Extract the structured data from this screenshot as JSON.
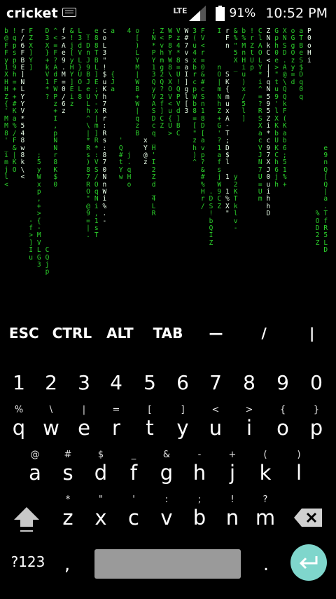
{
  "status_bar": {
    "carrier": "cricket",
    "network": "LTE",
    "battery_percent": "91%",
    "time": "10:52 PM",
    "icons": [
      "keyboard-icon",
      "signal-icon",
      "battery-icon"
    ]
  },
  "matrix": {
    "color": "#2cd22c",
    "columns": [
      "b\n@\nF\nF\ny\n1\nX\nH\nH\nZ\n{\n'\nM\nM\n8\n'\n_\ni\nm\nj\nl\n<",
      "!\nq\np\ns\np\n9\nh\n=\n+\n+\n#\nK\na\n%\n/\nF\n&\n|\nK\nO",
      "r\n/\n6\nF\nB\nE\n]\nN\nL\nY\nY\nV\n*\n5\n4\n8\nw\n8\nk\n\\\n<",
      "F\nZ\nX\n]\nY\n]\n\n\n\n\n\n\n\n\n\n\n\n\n\n\n\n\n\n\n\n\n-\nf\n>\n]\nI\nu",
      "\n\n\n\n\n\n\n\n\n\n\n\n\n\n\n\n\n;\n5\ny\nW\nx\np\n,\n+\n>\n{\n-\nM\nV\nL\nG\n3",
      "D\n3\nX\n}\n+\nk\nV\n1\n*\n?\n\n\n\n\n\n\n\n\n\n\n\n\n\n\n\n\n\n\n\n\nC\nQ\nj\np",
      "^\n<\n=\nF\n?\nA\nd\nF\nW\nP\nz\n+\nI\n,\np\nN\nN\nr\n8\nK\n$\n0",
      "f\n>\nA\ne\n9\n.\nM\n=\n0\n/\n6\nz",
      "&\n!\nj\n[\ny\nH\nY\n]\nE\ni\nz",
      "L\n3\nd\nV\nL\n}\nU\nO\nL\n8",
      "_\n!\nD\nn\nJ\n9\nB\nJ\ne\nU\nL\nh\n^\n\\\n|\n*\nR\ns\n)\n8\n7\nR\nO\n\"\n@\n9\n=\n|\n.",
      "e\n8\n8\nT\nB\nL\n]\nE\n;\nY\n-\nx\n|\nm\n]\nR\n*\n:\nV\nS\n/\nO\nq\nN\ni\n,\n1\ns\nT",
      "c\no\nL\n3\n\"\n!\n$\nu\nK\nh\n7\nR\nr\n:\nR\ns\n:\n8\n7\n0\nN\nn\nW\ni\n%\n.\n-",
      "a\n\n\n\n\n\n{\nJ\na",
      "\n\n\n\n\n\n\n\n\n\n\n\n\n\n\n'\nQ\n#\nt\nY\nw",
      "4\n\n\n\n\n\n\n\n\n\n\n\n\n\n\n\n\nj\n.\nq\nH\no",
      "o\n[\n)\nL\nY\nM\n|\nW\nB\n+\nW\n|\nq\nz\nB",
      "\n\n\n\n\n\n\n\n\n\n\n\n\n\n\nx\nY\n@\nz",
      ";\nN\n*\nP\nY\n1\n3\nQ\ny\nV\nA\nS\nD\nc\nq\n_\nH\n'\nI\n2\nZ\nd\n_\n4\nL\nR",
      "Z\n<\nv\nh\nm\ng\n2\nQ\n?\n2\nf\n]\nC\nZ",
      "W\nP\n8\nY\nW\n8\n\\\nX\nO\nV\n<\nu\n{\nU\n>",
      "V\nz\n4\n*\n8\n=\nU\n!\nQ\nP\nV\nd\n]\nB\nC",
      "W\n#\n7\nv\ns\na\nI\n]\ng\nl\n[\n3",
      "3\n(\nu\n4\nx\nb\nr\nc\np\nW\nb\n8\n=\n[\n\"\nz\nh\n)\n^",
      "F\nV\n<\nr\n=\n0\n&\n#\nc\nS\nn\n1\n8\nD\n[\na\nv\np\n?\n&\n#\n%\nH\nr\n/",
      "\n\n\n\n\n\n\n\n\n\n\n\n\n\n\n\n\n\n\n\n\n\n.\nD\nS\n!\nb\nQ\nI\nZ",
      "I\n\n\n\n\nn\nO\n|\nm\nN\nh\nZ\n+\nG\n'\n?\n1\na\nf\ns\nj\nW\n9\nC\nZ",
      "r\nF\nn\n\n\n\nS\nK\n{\nm\nu\nx\nA\n-\nT\n;\nD\n$\nl\n\n1\n\n1\n%\nX\n\"",
      "&\n%\n\"\n5\nX\n_\n\n\n\n\n\n\n\n\n\n\n\n\n\n\ny\n2\nK\nT\nk\nl\nv\n-",
      "b\n%\nM\nn\nH\ni\nu\n)\nx\n/\n5\nl\n]",
      "!\nr\nZ\nt\nU\np",
      "C\nl\nA\nO\nL\nY\n*\ni\n^\n=\n?\nR\nS\nX\na\nc\nV\nJ\nN\n7\nU\n=\nU\nm",
      "Z\nN\nk\nC\n<\n|\n]\nq\nN\n5\n9\n5\nZ\ni\n*\nc\n9\n7\nX\nJ\n0\nu\ni\nh\nh\nD",
      "G\np\nh\n0\ne\n>\n\"\nt\nu\n9\n'\nl\nX\nK\nb\nU\nK\nC\nh\n6\nj\nh",
      "X\nN\nS\nD\n.\nA\n@\n\\\nQ\nQ\nk\nF\n(\nK\na\nb\n6\n;\n5\n1\n%\n+",
      "o\nG\ng\nO\nz\ny\n=\nd",
      "a\nT\nB\ne\nS\n$\nD\nq\n0\nq",
      "P\n0\no\nH\ni",
      "\n\n\n\n\n\n\n\n\n\n\n\n\n\n\n\n\n\n\n\n\n\n\n\n\n%\nO\nD\n2\nZ",
      "\n\n\n\n\n\n\n\n\n\n\n\n\n\n\n\ne\n9\nn\nQ\n[\nQ\n|\na\n.\nT\nf\nR\n5\nL\nD"
    ]
  },
  "extra_row": [
    "ESC",
    "CTRL",
    "ALT",
    "TAB",
    "—",
    "/",
    "|"
  ],
  "number_row": [
    "1",
    "2",
    "3",
    "4",
    "5",
    "6",
    "7",
    "8",
    "9",
    "0"
  ],
  "row1": {
    "keys": [
      "q",
      "w",
      "e",
      "r",
      "t",
      "y",
      "u",
      "i",
      "o",
      "p"
    ],
    "hints": [
      "%",
      "\\",
      "|",
      "=",
      "[",
      "]",
      "<",
      ">",
      "{",
      "}"
    ]
  },
  "row2": {
    "keys": [
      "a",
      "s",
      "d",
      "f",
      "g",
      "h",
      "j",
      "k",
      "l"
    ],
    "hints": [
      "@",
      "#",
      "$",
      "_",
      "&",
      "-",
      "+",
      "(",
      ")"
    ]
  },
  "row3": {
    "keys": [
      "z",
      "x",
      "c",
      "v",
      "b",
      "n",
      "m"
    ],
    "hints": [
      "*",
      "\"",
      "'",
      ":",
      ";",
      "!",
      "?"
    ]
  },
  "bottom_row": {
    "symbols_label": "?123",
    "comma": ",",
    "period": "."
  },
  "colors": {
    "background": "#000000",
    "enter_key": "#7fd6cc",
    "spacebar": "#9a9a9a"
  }
}
